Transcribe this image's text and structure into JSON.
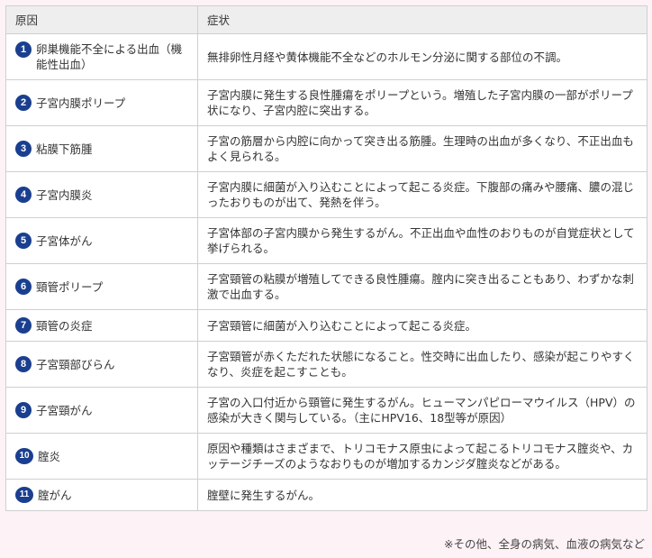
{
  "table": {
    "headers": [
      "原因",
      "症状"
    ],
    "rows": [
      {
        "num": "1",
        "cause": "卵巣機能不全による出血（機能性出血）",
        "symptom": "無排卵性月経や黄体機能不全などのホルモン分泌に関する部位の不調。"
      },
      {
        "num": "2",
        "cause": "子宮内膜ポリープ",
        "symptom": "子宮内膜に発生する良性腫瘍をポリープという。増殖した子宮内膜の一部がポリープ状になり、子宮内腔に突出する。"
      },
      {
        "num": "3",
        "cause": "粘膜下筋腫",
        "symptom": "子宮の筋層から内腔に向かって突き出る筋腫。生理時の出血が多くなり、不正出血もよく見られる。"
      },
      {
        "num": "4",
        "cause": "子宮内膜炎",
        "symptom": "子宮内膜に細菌が入り込むことによって起こる炎症。下腹部の痛みや腰痛、膿の混じったおりものが出て、発熱を伴う。"
      },
      {
        "num": "5",
        "cause": "子宮体がん",
        "symptom": "子宮体部の子宮内膜から発生するがん。不正出血や血性のおりものが自覚症状として挙げられる。"
      },
      {
        "num": "6",
        "cause": "頸管ポリープ",
        "symptom": "子宮頸管の粘膜が増殖してできる良性腫瘍。腟内に突き出ることもあり、わずかな刺激で出血する。"
      },
      {
        "num": "7",
        "cause": "頸管の炎症",
        "symptom": "子宮頸管に細菌が入り込むことによって起こる炎症。"
      },
      {
        "num": "8",
        "cause": "子宮頸部びらん",
        "symptom": "子宮頸管が赤くただれた状態になること。性交時に出血したり、感染が起こりやすくなり、炎症を起こすことも。"
      },
      {
        "num": "9",
        "cause": "子宮頸がん",
        "symptom": "子宮の入口付近から頸管に発生するがん。ヒューマンパピローマウイルス（HPV）の感染が大きく関与している。（主にHPV16、18型等が原因）"
      },
      {
        "num": "10",
        "cause": "腟炎",
        "symptom": "原因や種類はさまざまで、トリコモナス原虫によって起こるトリコモナス腟炎や、カッテージチーズのようなおりものが増加するカンジダ腟炎などがある。"
      },
      {
        "num": "11",
        "cause": "腟がん",
        "symptom": "腟壁に発生するがん。"
      }
    ]
  },
  "footnote": "※その他、全身の病気、血液の病気など",
  "colors": {
    "page_bg": "#fdf2f6",
    "header_bg": "#eeeeee",
    "badge": "#1a3f8f",
    "border": "#cfcfcf"
  }
}
